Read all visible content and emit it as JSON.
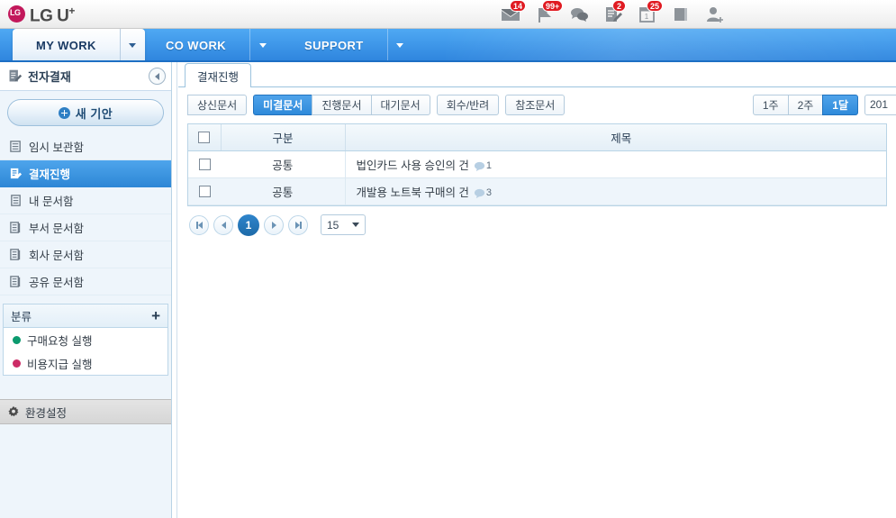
{
  "header": {
    "logo_text": "LG U",
    "logo_sup": "+",
    "notifications": [
      {
        "icon": "mail-icon",
        "count": "14"
      },
      {
        "icon": "flag-icon",
        "count": "99+"
      },
      {
        "icon": "chat-icon",
        "count": ""
      },
      {
        "icon": "document-edit-icon",
        "count": "2"
      },
      {
        "icon": "calendar-icon",
        "count": "25"
      },
      {
        "icon": "book-icon",
        "count": ""
      },
      {
        "icon": "add-user-icon",
        "count": ""
      }
    ]
  },
  "navbar": {
    "items": [
      {
        "label": "MY WORK",
        "active": true
      },
      {
        "label": "CO WORK",
        "active": false
      },
      {
        "label": "SUPPORT",
        "active": false
      }
    ]
  },
  "sidebar": {
    "title": "전자결재",
    "new_draft_label": "새 기안",
    "items": [
      {
        "label": "임시 보관함",
        "icon": "archive-icon",
        "active": false
      },
      {
        "label": "결재진행",
        "icon": "approval-icon",
        "active": true
      },
      {
        "label": "내 문서함",
        "icon": "folder-icon",
        "active": false
      },
      {
        "label": "부서 문서함",
        "icon": "folder-icon",
        "active": false
      },
      {
        "label": "회사 문서함",
        "icon": "folder-icon",
        "active": false
      },
      {
        "label": "공유 문서함",
        "icon": "folder-icon",
        "active": false
      }
    ],
    "category": {
      "title": "분류",
      "add_label": "+",
      "items": [
        {
          "label": "구매요청 실행",
          "color": "#0b9a6e"
        },
        {
          "label": "비용지급 실행",
          "color": "#cc2b66"
        }
      ]
    },
    "settings_label": "환경설정"
  },
  "main": {
    "tab_label": "결재진행",
    "filters": [
      {
        "label": "상신문서",
        "active": false
      },
      {
        "label": "미결문서",
        "active": true
      },
      {
        "label": "진행문서",
        "active": false
      },
      {
        "label": "대기문서",
        "active": false
      },
      {
        "label": "회수/반려",
        "active": false
      },
      {
        "label": "참조문서",
        "active": false
      }
    ],
    "period_filters": [
      {
        "label": "1주",
        "active": false
      },
      {
        "label": "2주",
        "active": false
      },
      {
        "label": "1달",
        "active": true
      }
    ],
    "date_value": "201",
    "table": {
      "headers": {
        "gubun": "구분",
        "title": "제목"
      },
      "rows": [
        {
          "gubun": "공통",
          "title": "법인카드 사용 승인의 건",
          "comments": "1"
        },
        {
          "gubun": "공통",
          "title": "개발용 노트북 구매의 건",
          "comments": "3"
        }
      ]
    },
    "pagination": {
      "current_page": "1",
      "page_size": "15"
    }
  }
}
